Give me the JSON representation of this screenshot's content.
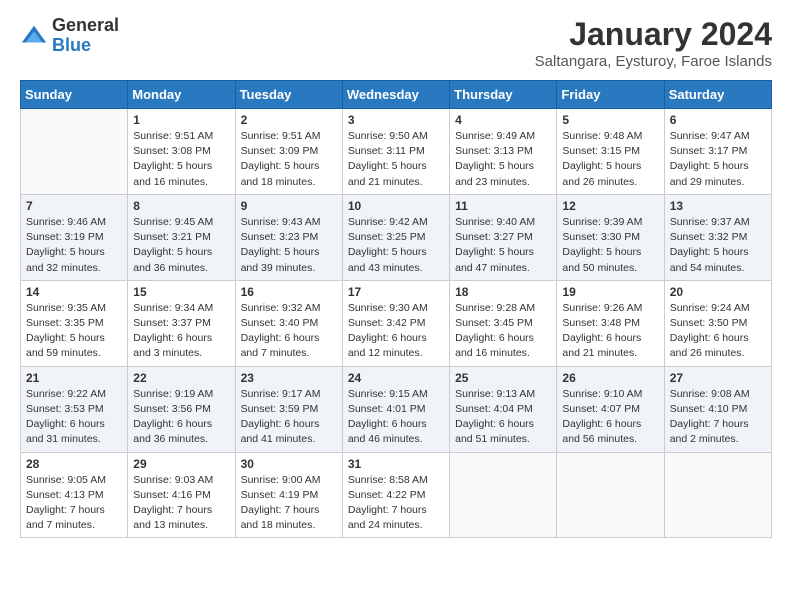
{
  "logo": {
    "general": "General",
    "blue": "Blue"
  },
  "title": "January 2024",
  "subtitle": "Saltangara, Eysturoy, Faroe Islands",
  "days_header": [
    "Sunday",
    "Monday",
    "Tuesday",
    "Wednesday",
    "Thursday",
    "Friday",
    "Saturday"
  ],
  "weeks": [
    [
      {
        "num": "",
        "info": ""
      },
      {
        "num": "1",
        "info": "Sunrise: 9:51 AM\nSunset: 3:08 PM\nDaylight: 5 hours\nand 16 minutes."
      },
      {
        "num": "2",
        "info": "Sunrise: 9:51 AM\nSunset: 3:09 PM\nDaylight: 5 hours\nand 18 minutes."
      },
      {
        "num": "3",
        "info": "Sunrise: 9:50 AM\nSunset: 3:11 PM\nDaylight: 5 hours\nand 21 minutes."
      },
      {
        "num": "4",
        "info": "Sunrise: 9:49 AM\nSunset: 3:13 PM\nDaylight: 5 hours\nand 23 minutes."
      },
      {
        "num": "5",
        "info": "Sunrise: 9:48 AM\nSunset: 3:15 PM\nDaylight: 5 hours\nand 26 minutes."
      },
      {
        "num": "6",
        "info": "Sunrise: 9:47 AM\nSunset: 3:17 PM\nDaylight: 5 hours\nand 29 minutes."
      }
    ],
    [
      {
        "num": "7",
        "info": "Sunrise: 9:46 AM\nSunset: 3:19 PM\nDaylight: 5 hours\nand 32 minutes."
      },
      {
        "num": "8",
        "info": "Sunrise: 9:45 AM\nSunset: 3:21 PM\nDaylight: 5 hours\nand 36 minutes."
      },
      {
        "num": "9",
        "info": "Sunrise: 9:43 AM\nSunset: 3:23 PM\nDaylight: 5 hours\nand 39 minutes."
      },
      {
        "num": "10",
        "info": "Sunrise: 9:42 AM\nSunset: 3:25 PM\nDaylight: 5 hours\nand 43 minutes."
      },
      {
        "num": "11",
        "info": "Sunrise: 9:40 AM\nSunset: 3:27 PM\nDaylight: 5 hours\nand 47 minutes."
      },
      {
        "num": "12",
        "info": "Sunrise: 9:39 AM\nSunset: 3:30 PM\nDaylight: 5 hours\nand 50 minutes."
      },
      {
        "num": "13",
        "info": "Sunrise: 9:37 AM\nSunset: 3:32 PM\nDaylight: 5 hours\nand 54 minutes."
      }
    ],
    [
      {
        "num": "14",
        "info": "Sunrise: 9:35 AM\nSunset: 3:35 PM\nDaylight: 5 hours\nand 59 minutes."
      },
      {
        "num": "15",
        "info": "Sunrise: 9:34 AM\nSunset: 3:37 PM\nDaylight: 6 hours\nand 3 minutes."
      },
      {
        "num": "16",
        "info": "Sunrise: 9:32 AM\nSunset: 3:40 PM\nDaylight: 6 hours\nand 7 minutes."
      },
      {
        "num": "17",
        "info": "Sunrise: 9:30 AM\nSunset: 3:42 PM\nDaylight: 6 hours\nand 12 minutes."
      },
      {
        "num": "18",
        "info": "Sunrise: 9:28 AM\nSunset: 3:45 PM\nDaylight: 6 hours\nand 16 minutes."
      },
      {
        "num": "19",
        "info": "Sunrise: 9:26 AM\nSunset: 3:48 PM\nDaylight: 6 hours\nand 21 minutes."
      },
      {
        "num": "20",
        "info": "Sunrise: 9:24 AM\nSunset: 3:50 PM\nDaylight: 6 hours\nand 26 minutes."
      }
    ],
    [
      {
        "num": "21",
        "info": "Sunrise: 9:22 AM\nSunset: 3:53 PM\nDaylight: 6 hours\nand 31 minutes."
      },
      {
        "num": "22",
        "info": "Sunrise: 9:19 AM\nSunset: 3:56 PM\nDaylight: 6 hours\nand 36 minutes."
      },
      {
        "num": "23",
        "info": "Sunrise: 9:17 AM\nSunset: 3:59 PM\nDaylight: 6 hours\nand 41 minutes."
      },
      {
        "num": "24",
        "info": "Sunrise: 9:15 AM\nSunset: 4:01 PM\nDaylight: 6 hours\nand 46 minutes."
      },
      {
        "num": "25",
        "info": "Sunrise: 9:13 AM\nSunset: 4:04 PM\nDaylight: 6 hours\nand 51 minutes."
      },
      {
        "num": "26",
        "info": "Sunrise: 9:10 AM\nSunset: 4:07 PM\nDaylight: 6 hours\nand 56 minutes."
      },
      {
        "num": "27",
        "info": "Sunrise: 9:08 AM\nSunset: 4:10 PM\nDaylight: 7 hours\nand 2 minutes."
      }
    ],
    [
      {
        "num": "28",
        "info": "Sunrise: 9:05 AM\nSunset: 4:13 PM\nDaylight: 7 hours\nand 7 minutes."
      },
      {
        "num": "29",
        "info": "Sunrise: 9:03 AM\nSunset: 4:16 PM\nDaylight: 7 hours\nand 13 minutes."
      },
      {
        "num": "30",
        "info": "Sunrise: 9:00 AM\nSunset: 4:19 PM\nDaylight: 7 hours\nand 18 minutes."
      },
      {
        "num": "31",
        "info": "Sunrise: 8:58 AM\nSunset: 4:22 PM\nDaylight: 7 hours\nand 24 minutes."
      },
      {
        "num": "",
        "info": ""
      },
      {
        "num": "",
        "info": ""
      },
      {
        "num": "",
        "info": ""
      }
    ]
  ]
}
